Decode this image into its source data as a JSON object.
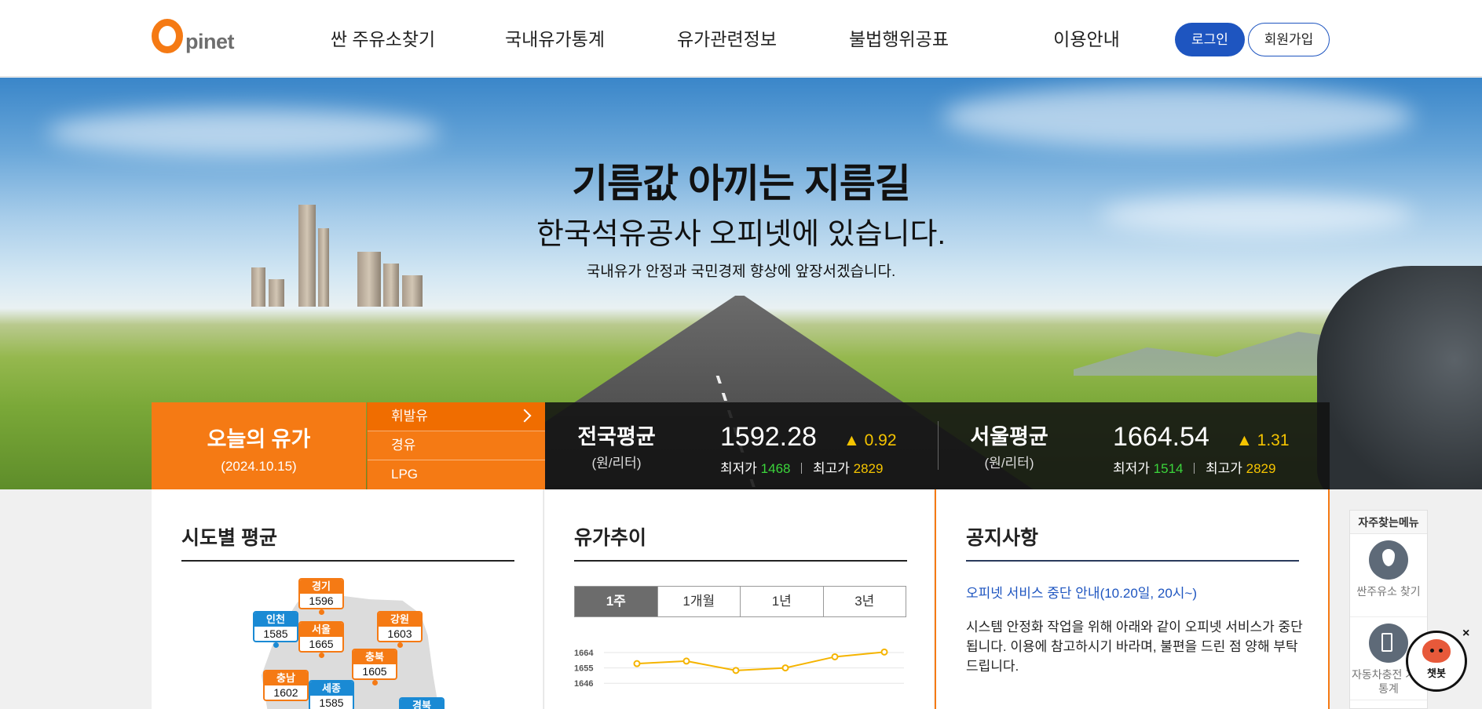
{
  "header": {
    "logo_mark": "O",
    "logo_text": "pinet",
    "nav": [
      "싼 주유소찾기",
      "국내유가통계",
      "유가관련정보",
      "불법행위공표",
      "이용안내"
    ],
    "login_label": "로그인",
    "join_label": "회원가입",
    "login_color": "#1e55c0"
  },
  "hero": {
    "title": "기름값 아끼는 지름길",
    "subtitle": "한국석유공사 오피넷에 있습니다.",
    "description": "국내유가 안정과 국민경제 향상에 앞장서겠습니다."
  },
  "today_price": {
    "title": "오늘의 유가",
    "date": "(2024.10.15)",
    "fuel_tabs": [
      "휘발유",
      "경유",
      "LPG"
    ],
    "active_fuel": "휘발유",
    "accent_color": "#f57a14",
    "national": {
      "label": "전국평균",
      "unit": "(원/리터)",
      "value": "1592.28",
      "change": "0.92",
      "min_label": "최저가",
      "min": "1468",
      "max_label": "최고가",
      "max": "2829"
    },
    "seoul": {
      "label": "서울평균",
      "unit": "(원/리터)",
      "value": "1664.54",
      "change": "1.31",
      "min_label": "최저가",
      "min": "1514",
      "max_label": "최고가",
      "max": "2829"
    }
  },
  "regional": {
    "title": "시도별 평균",
    "regions": [
      {
        "name": "경기",
        "price": "1596",
        "color": "orange"
      },
      {
        "name": "인천",
        "price": "1585",
        "color": "blue"
      },
      {
        "name": "서울",
        "price": "1665",
        "color": "orange"
      },
      {
        "name": "강원",
        "price": "1603",
        "color": "orange"
      },
      {
        "name": "충북",
        "price": "1605",
        "color": "orange"
      },
      {
        "name": "충남",
        "price": "1602",
        "color": "orange"
      },
      {
        "name": "세종",
        "price": "1585",
        "color": "blue"
      },
      {
        "name": "경북",
        "price": "",
        "color": "blue"
      }
    ]
  },
  "trend": {
    "title": "유가추이",
    "periods": [
      "1주",
      "1개월",
      "1년",
      "3년"
    ],
    "active_period": "1주"
  },
  "chart_data": {
    "type": "line",
    "title": "",
    "xlabel": "",
    "ylabel": "",
    "y_ticks": [
      1664,
      1655,
      1646
    ],
    "ylim": [
      1646,
      1664
    ],
    "grid": true,
    "color": "#f5b400",
    "values": [
      1657.5,
      1659,
      1653.5,
      1655,
      1661.5,
      1664.3
    ]
  },
  "notice": {
    "title": "공지사항",
    "link": "오피넷 서비스 중단 안내(10.20일, 20시~)",
    "text": "시스템 안정화 작업을 위해 아래와 같이 오피넷 서비스가 중단됩니다. 이용에 참고하시기 바라며, 불편을 드린 점 양해 부탁드립니다."
  },
  "quick_menu": {
    "title": "자주찾는메뉴",
    "items": [
      {
        "label": "싼주유소 찾기",
        "icon": "location-pin-icon"
      },
      {
        "label": "자동차충전 가격통계",
        "icon": "fuel-pump-icon"
      }
    ]
  },
  "chatbot": {
    "label": "챗봇",
    "close": "×"
  }
}
